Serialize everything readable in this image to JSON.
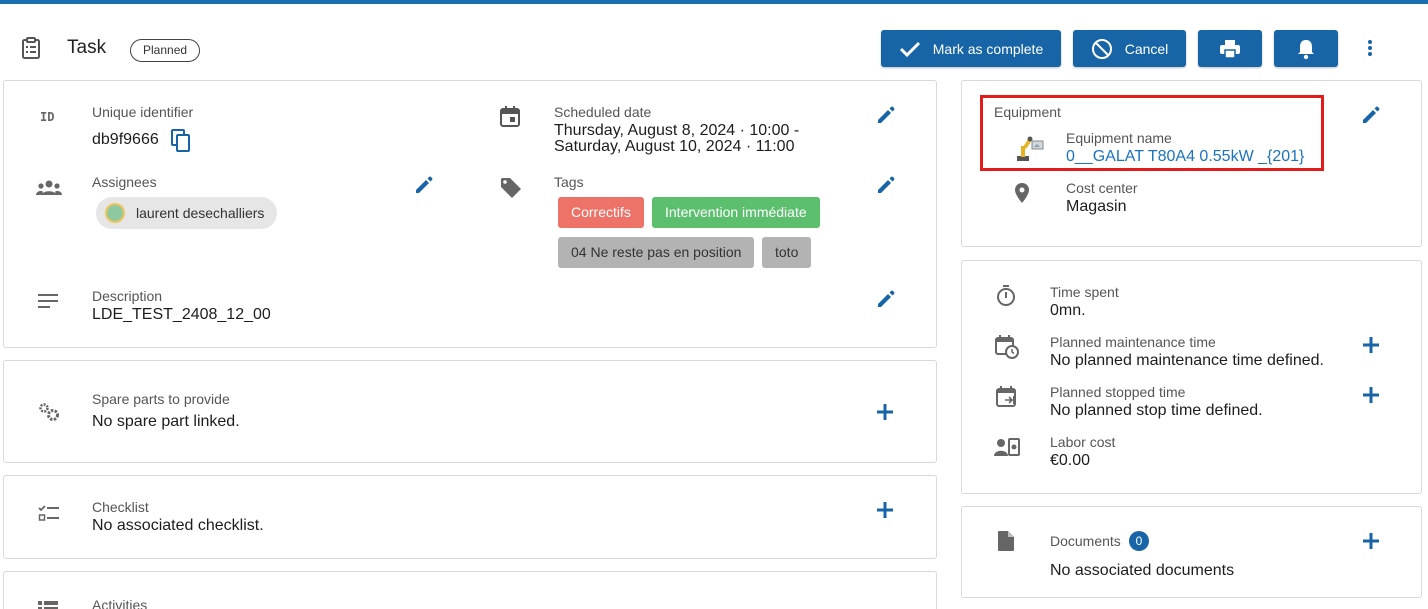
{
  "header": {
    "title": "Task",
    "status": "Planned",
    "actions": {
      "complete": "Mark as complete",
      "cancel": "Cancel"
    }
  },
  "details": {
    "id_icon_text": "ID",
    "id_label": "Unique identifier",
    "id_value": "db9f9666",
    "scheduled_label": "Scheduled date",
    "scheduled_line1": "Thursday, August 8, 2024 · 10:00 -",
    "scheduled_line2": "Saturday, August 10, 2024 · 11:00",
    "assignees_label": "Assignees",
    "assignee_name": "laurent desechalliers",
    "tags_label": "Tags",
    "tags": [
      "Correctifs",
      "Intervention immédiate",
      "04 Ne reste pas en position",
      "toto"
    ],
    "description_label": "Description",
    "description_value": "LDE_TEST_2408_12_00"
  },
  "spare_parts": {
    "label": "Spare parts to provide",
    "value": "No spare part linked."
  },
  "checklist": {
    "label": "Checklist",
    "value": "No associated checklist."
  },
  "activities": {
    "label": "Activities"
  },
  "equipment": {
    "section_label": "Equipment",
    "name_label": "Equipment name",
    "name_value": "0__GALAT T80A4 0.55kW _{201}",
    "cost_center_label": "Cost center",
    "cost_center_value": "Magasin"
  },
  "time": {
    "spent_label": "Time spent",
    "spent_value": "0mn.",
    "planned_maint_label": "Planned maintenance time",
    "planned_maint_value": "No planned maintenance time defined.",
    "planned_stop_label": "Planned stopped time",
    "planned_stop_value": "No planned stop time defined.",
    "labor_label": "Labor cost",
    "labor_value": "€0.00"
  },
  "documents": {
    "label": "Documents",
    "count": "0",
    "value": "No associated documents"
  },
  "colors": {
    "primary": "#1765a7",
    "tag_red": "#ed7268",
    "tag_green": "#5cbf6e",
    "tag_gray": "#b3b3b3",
    "highlight": "#e21b1b"
  }
}
